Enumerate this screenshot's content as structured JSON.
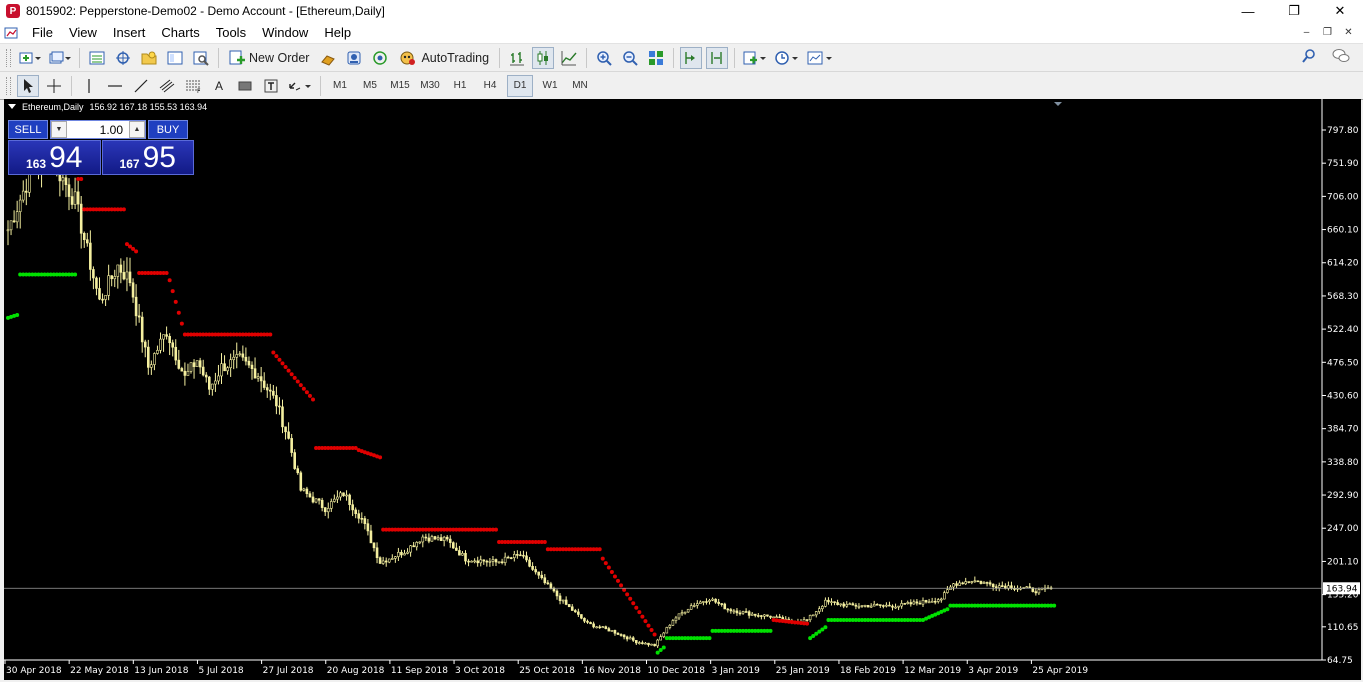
{
  "window": {
    "title": "8015902: Pepperstone-Demo02 - Demo Account - [Ethereum,Daily]",
    "minimize": "—",
    "maximize": "❐",
    "close": "✕"
  },
  "menu": {
    "items": [
      "File",
      "View",
      "Insert",
      "Charts",
      "Tools",
      "Window",
      "Help"
    ],
    "mdi_minimize": "–",
    "mdi_restore": "❐",
    "mdi_close": "✕"
  },
  "toolbar": {
    "new_order": "New Order",
    "autotrading": "AutoTrading"
  },
  "timeframes": {
    "items": [
      "M1",
      "M5",
      "M15",
      "M30",
      "H1",
      "H4",
      "D1",
      "W1",
      "MN"
    ],
    "active": "D1"
  },
  "drawing_tools": {
    "text_tool": "A"
  },
  "chart": {
    "symbol_label": "Ethereum,Daily",
    "ohlc": "156.92 167.18 155.53 163.94",
    "current_price_label": "163.94"
  },
  "trade_panel": {
    "sell_label": "SELL",
    "buy_label": "BUY",
    "lot_value": "1.00",
    "sell_price_small": "163",
    "sell_price_big": "94",
    "buy_price_small": "167",
    "buy_price_big": "95"
  },
  "colors": {
    "candle": "#f5f0a0",
    "sar_above": "#e00000",
    "sar_below": "#00e000",
    "background": "#000000",
    "axis_text": "#ffffff",
    "accent_blue": "#1f3fc0"
  },
  "chart_data": {
    "type": "candlestick",
    "symbol": "Ethereum",
    "timeframe": "Daily",
    "ylim": [
      64.75,
      820
    ],
    "y_ticks": [
      "797.80",
      "751.90",
      "706.00",
      "660.10",
      "614.20",
      "568.30",
      "522.40",
      "476.50",
      "430.60",
      "384.70",
      "338.80",
      "292.90",
      "247.00",
      "201.10",
      "155.20",
      "110.65",
      "64.75"
    ],
    "x_ticks": [
      "30 Apr 2018",
      "22 May 2018",
      "13 Jun 2018",
      "5 Jul 2018",
      "27 Jul 2018",
      "20 Aug 2018",
      "11 Sep 2018",
      "3 Oct 2018",
      "25 Oct 2018",
      "16 Nov 2018",
      "10 Dec 2018",
      "3 Jan 2019",
      "25 Jan 2019",
      "18 Feb 2019",
      "12 Mar 2019",
      "3 Apr 2019",
      "25 Apr 2019"
    ],
    "current_price": 163.94,
    "price_anchors": [
      [
        0,
        660
      ],
      [
        8,
        745
      ],
      [
        14,
        760
      ],
      [
        22,
        700
      ],
      [
        30,
        560
      ],
      [
        36,
        610
      ],
      [
        40,
        590
      ],
      [
        46,
        470
      ],
      [
        52,
        520
      ],
      [
        58,
        455
      ],
      [
        62,
        480
      ],
      [
        66,
        440
      ],
      [
        70,
        470
      ],
      [
        76,
        480
      ],
      [
        82,
        460
      ],
      [
        88,
        420
      ],
      [
        92,
        370
      ],
      [
        96,
        300
      ],
      [
        104,
        275
      ],
      [
        110,
        295
      ],
      [
        116,
        260
      ],
      [
        122,
        200
      ],
      [
        130,
        215
      ],
      [
        136,
        235
      ],
      [
        144,
        230
      ],
      [
        150,
        205
      ],
      [
        160,
        200
      ],
      [
        168,
        210
      ],
      [
        174,
        180
      ],
      [
        182,
        145
      ],
      [
        190,
        115
      ],
      [
        198,
        105
      ],
      [
        206,
        90
      ],
      [
        212,
        85
      ],
      [
        218,
        120
      ],
      [
        224,
        140
      ],
      [
        230,
        150
      ],
      [
        236,
        135
      ],
      [
        244,
        128
      ],
      [
        250,
        125
      ],
      [
        256,
        118
      ],
      [
        262,
        120
      ],
      [
        268,
        145
      ],
      [
        276,
        140
      ],
      [
        284,
        140
      ],
      [
        292,
        140
      ],
      [
        300,
        145
      ],
      [
        306,
        150
      ],
      [
        310,
        170
      ],
      [
        316,
        175
      ],
      [
        324,
        168
      ],
      [
        330,
        166
      ],
      [
        338,
        160
      ],
      [
        342,
        163.94
      ]
    ],
    "sar_segments": [
      {
        "position": "below",
        "from": 0,
        "to": 3,
        "start": 538,
        "end": 542
      },
      {
        "position": "below",
        "from": 4,
        "to": 22,
        "start": 598,
        "end": 598
      },
      {
        "position": "above",
        "from": 23,
        "to": 24,
        "start": 730,
        "end": 730
      },
      {
        "position": "above",
        "from": 25,
        "to": 38,
        "start": 688,
        "end": 688
      },
      {
        "position": "above",
        "from": 39,
        "to": 42,
        "start": 640,
        "end": 630
      },
      {
        "position": "above",
        "from": 43,
        "to": 52,
        "start": 600,
        "end": 600
      },
      {
        "position": "above",
        "from": 53,
        "to": 57,
        "start": 590,
        "end": 530
      },
      {
        "position": "above",
        "from": 58,
        "to": 86,
        "start": 515,
        "end": 515
      },
      {
        "position": "above",
        "from": 87,
        "to": 100,
        "start": 490,
        "end": 425
      },
      {
        "position": "above",
        "from": 101,
        "to": 114,
        "start": 358,
        "end": 358
      },
      {
        "position": "above",
        "from": 115,
        "to": 122,
        "start": 355,
        "end": 345
      },
      {
        "position": "above",
        "from": 123,
        "to": 160,
        "start": 245,
        "end": 245
      },
      {
        "position": "above",
        "from": 161,
        "to": 176,
        "start": 228,
        "end": 228
      },
      {
        "position": "above",
        "from": 177,
        "to": 194,
        "start": 218,
        "end": 218
      },
      {
        "position": "above",
        "from": 195,
        "to": 212,
        "start": 205,
        "end": 100
      },
      {
        "position": "below",
        "from": 213,
        "to": 215,
        "start": 75,
        "end": 82
      },
      {
        "position": "below",
        "from": 216,
        "to": 230,
        "start": 95,
        "end": 95
      },
      {
        "position": "below",
        "from": 231,
        "to": 250,
        "start": 105,
        "end": 105
      },
      {
        "position": "above",
        "from": 251,
        "to": 262,
        "start": 120,
        "end": 115
      },
      {
        "position": "below",
        "from": 263,
        "to": 268,
        "start": 95,
        "end": 110
      },
      {
        "position": "below",
        "from": 269,
        "to": 300,
        "start": 120,
        "end": 120
      },
      {
        "position": "below",
        "from": 301,
        "to": 308,
        "start": 122,
        "end": 135
      },
      {
        "position": "below",
        "from": 309,
        "to": 343,
        "start": 140,
        "end": 140
      }
    ]
  }
}
